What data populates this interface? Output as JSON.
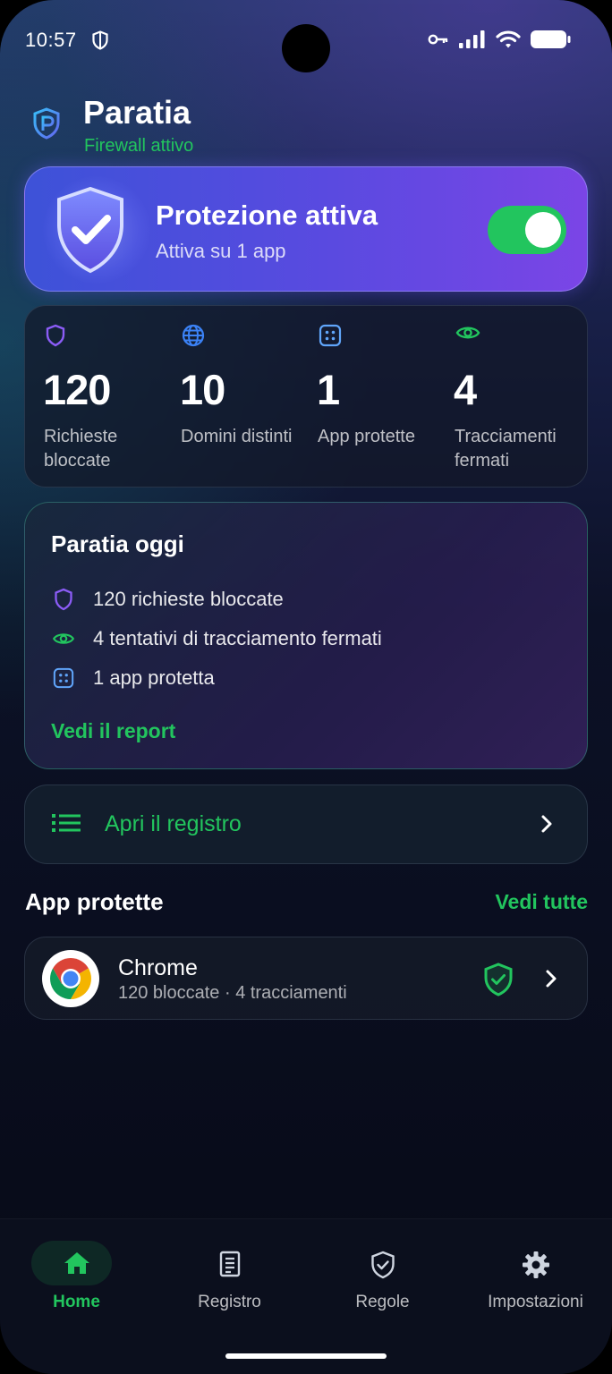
{
  "status_bar": {
    "time": "10:57",
    "icons": [
      "shield-outline-icon",
      "vpn-key-icon",
      "signal-icon",
      "wifi-icon",
      "battery-icon"
    ]
  },
  "header": {
    "title": "Paratia",
    "subtitle": "Firewall attivo"
  },
  "protection": {
    "title": "Protezione attiva",
    "subtitle": "Attiva su 1 app",
    "enabled": true
  },
  "stats": [
    {
      "icon": "shield-icon",
      "value": "120",
      "label": "Richieste bloccate",
      "color": "#8b5cf6"
    },
    {
      "icon": "globe-icon",
      "value": "10",
      "label": "Domini distinti",
      "color": "#3b82f6"
    },
    {
      "icon": "apps-icon",
      "value": "1",
      "label": "App protette",
      "color": "#60a5fa"
    },
    {
      "icon": "eye-icon",
      "value": "4",
      "label": "Tracciamenti fermati",
      "color": "#22c55e"
    }
  ],
  "today": {
    "title": "Paratia oggi",
    "rows": [
      {
        "icon": "shield-icon",
        "text": "120 richieste bloccate"
      },
      {
        "icon": "eye-icon",
        "text": "4 tentativi di tracciamento fermati"
      },
      {
        "icon": "apps-icon",
        "text": "1 app protetta"
      }
    ],
    "report_link": "Vedi il report"
  },
  "registry": {
    "label": "Apri il registro"
  },
  "protected_apps": {
    "title": "App protette",
    "see_all": "Vedi tutte",
    "items": [
      {
        "name": "Chrome",
        "meta": "120 bloccate · 4 tracciamenti",
        "icon": "chrome-icon"
      }
    ]
  },
  "nav": [
    {
      "label": "Home",
      "icon": "home-icon",
      "active": true
    },
    {
      "label": "Registro",
      "icon": "document-icon",
      "active": false
    },
    {
      "label": "Regole",
      "icon": "shield-check-icon",
      "active": false
    },
    {
      "label": "Impostazioni",
      "icon": "gear-icon",
      "active": false
    }
  ],
  "colors": {
    "accent": "#22c55e",
    "card_gradient_start": "#3d52d8",
    "card_gradient_end": "#7b45e6"
  }
}
